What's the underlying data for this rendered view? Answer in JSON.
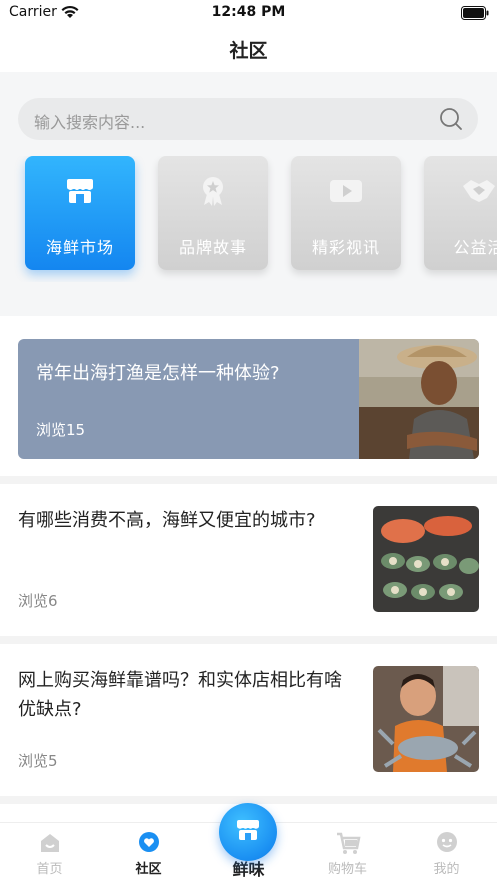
{
  "status_bar": {
    "carrier": "Carrier",
    "time": "12:48 PM",
    "wifi_icon": "wifi-icon",
    "battery_icon": "battery-icon"
  },
  "header": {
    "title": "社区"
  },
  "search": {
    "placeholder": "输入搜索内容...",
    "icon": "search-icon"
  },
  "categories": [
    {
      "label": "海鲜市场",
      "icon": "store-icon",
      "active": true
    },
    {
      "label": "品牌故事",
      "icon": "award-icon",
      "active": false
    },
    {
      "label": "精彩视讯",
      "icon": "video-play-icon",
      "active": false
    },
    {
      "label": "公益活",
      "icon": "handshake-icon",
      "active": false
    }
  ],
  "featured": {
    "title": "常年出海打渔是怎样一种体验?",
    "views": "浏览15"
  },
  "articles": [
    {
      "title": "有哪些消费不高，海鲜又便宜的城市?",
      "views": "浏览6"
    },
    {
      "title": "网上购买海鲜靠谱吗？和实体店相比有啥优缺点?",
      "views": "浏览5"
    }
  ],
  "tab_bar": {
    "items": [
      {
        "label": "首页",
        "icon": "home-icon",
        "active": false
      },
      {
        "label": "社区",
        "icon": "community-icon",
        "active": true
      },
      {
        "label": "鲜味",
        "icon": "store-icon",
        "active": false
      },
      {
        "label": "购物车",
        "icon": "cart-icon",
        "active": false
      },
      {
        "label": "我的",
        "icon": "profile-icon",
        "active": false
      }
    ]
  },
  "colors": {
    "accent": "#1a8ff2",
    "featured_bg": "#8899b3",
    "inactive_tab": "#bbbbbb"
  }
}
